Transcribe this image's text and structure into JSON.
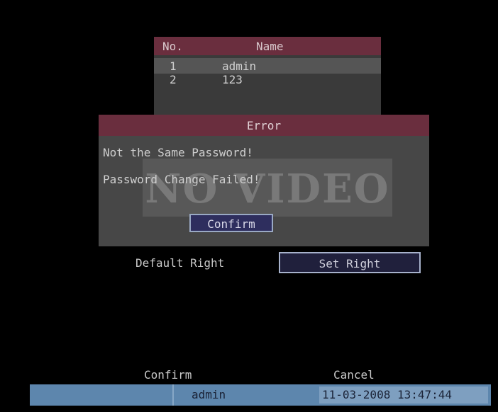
{
  "user_table": {
    "headers": {
      "no": "No.",
      "name": "Name"
    },
    "rows": [
      {
        "no": "1",
        "name": "admin"
      },
      {
        "no": "2",
        "name": "123"
      }
    ]
  },
  "error_dialog": {
    "title": "Error",
    "message_1": "Not the Same Password!",
    "message_2": "Password Change Failed!",
    "confirm_label": "Confirm"
  },
  "overlay": {
    "text": "NO VIDEO"
  },
  "rights": {
    "default_right_label": "Default Right",
    "set_right_label": "Set Right"
  },
  "footer_buttons": {
    "confirm_label": "Confirm",
    "cancel_label": "Cancel"
  },
  "status_bar": {
    "user": "admin",
    "datetime": "11-03-2008 13:47:44"
  },
  "colors": {
    "title_bar": "#6a2e3e",
    "dialog_bg": "#474747",
    "status_bar": "#5d86ad"
  }
}
